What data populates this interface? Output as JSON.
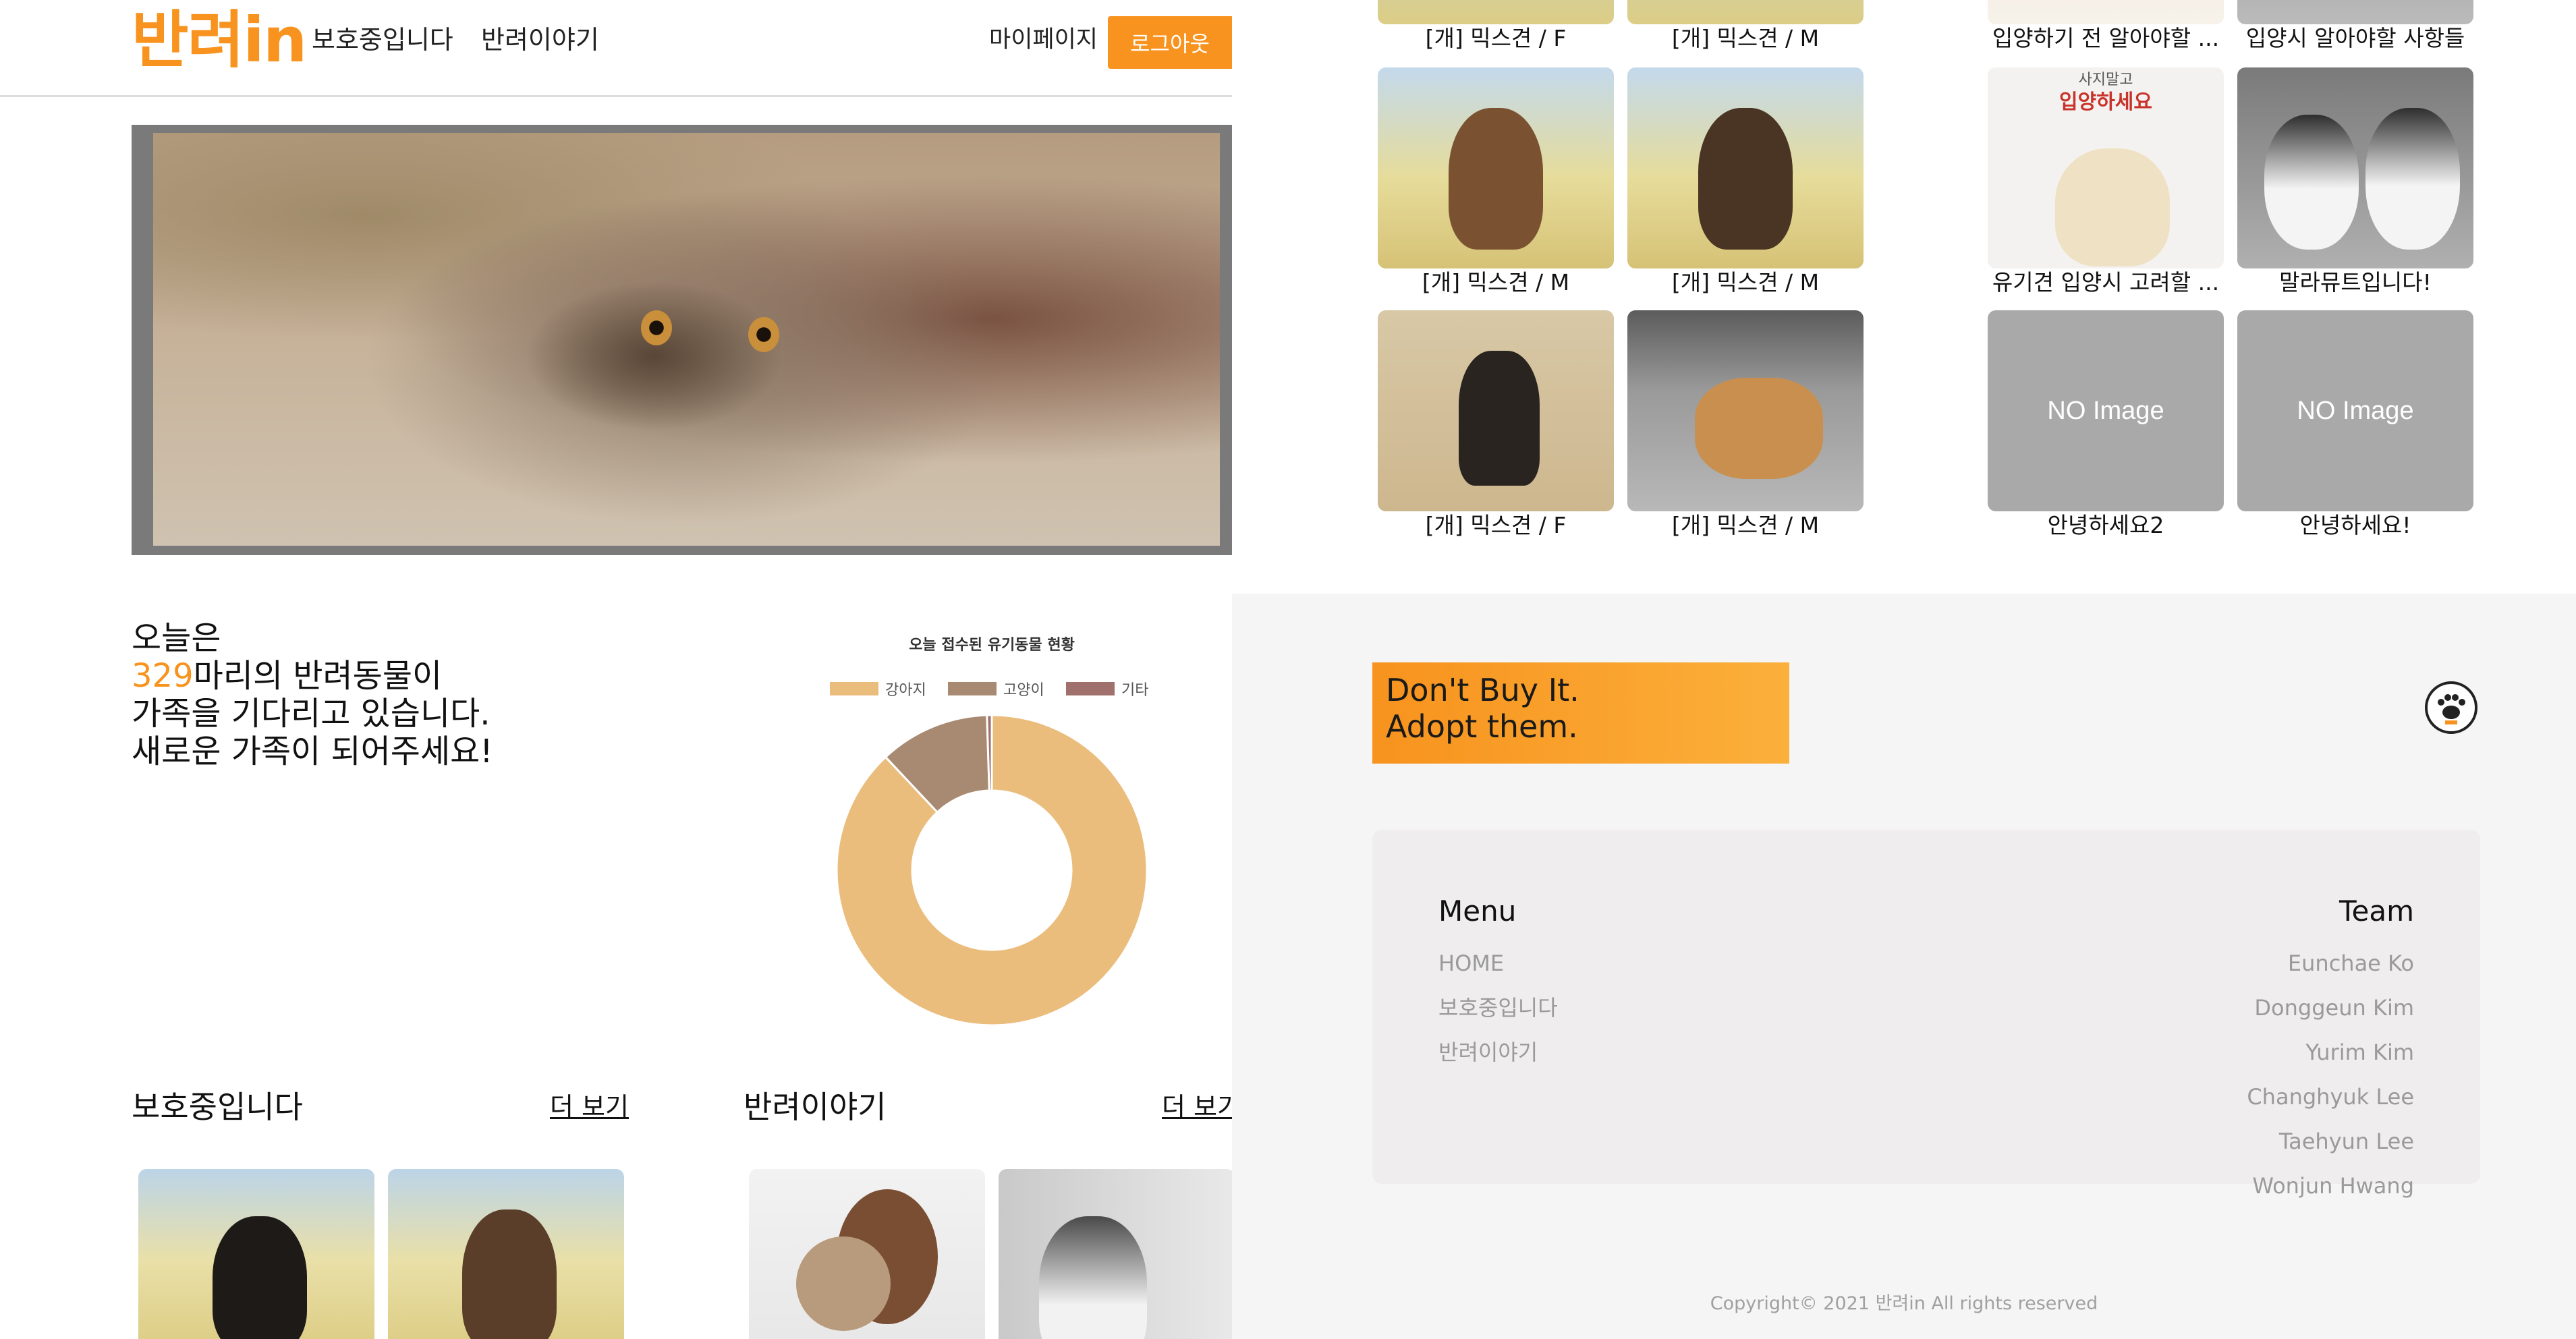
{
  "header": {
    "logo": "반려in",
    "nav": [
      "보호중입니다",
      "반려이야기"
    ],
    "mypage": "마이페이지",
    "logout": "로그아웃"
  },
  "intro": {
    "line1": "오늘은",
    "count": "329",
    "line2_suffix": "마리의 반려동물이",
    "line3": "가족을 기다리고 있습니다.",
    "line4": "새로운 가족이 되어주세요!"
  },
  "chart_data": {
    "type": "pie",
    "title": "오늘 접수된 유기동물 현황",
    "categories": [
      "강아지",
      "고양이",
      "기타"
    ],
    "values": [
      88,
      11.5,
      0.5
    ],
    "colors": [
      "#ebbd7d",
      "#a88a72",
      "#a0706c"
    ],
    "legend_position": "top"
  },
  "sections": {
    "protect": {
      "title": "보호중입니다",
      "more": "더 보기"
    },
    "story": {
      "title": "반려이야기",
      "more": "더 보기"
    }
  },
  "animals": [
    {
      "label": "[개] 믹스견 / F"
    },
    {
      "label": "[개] 믹스견 / M"
    },
    {
      "label": "[개] 믹스견 / M"
    },
    {
      "label": "[개] 믹스견 / M"
    },
    {
      "label": "[개] 믹스견 / F"
    },
    {
      "label": "[개] 믹스견 / M"
    }
  ],
  "stories": [
    {
      "label": "입양하기 전 알아야할 ..."
    },
    {
      "label": "입양시 알아야할 사항들"
    },
    {
      "label": "유기견 입양시 고려할 ...",
      "poster_small": "사지말고",
      "poster_big": "입양하세요"
    },
    {
      "label": "말라뮤트입니다!"
    },
    {
      "label": "안녕하세요2",
      "noimage": "NO Image"
    },
    {
      "label": "안녕하세요!",
      "noimage": "NO Image"
    }
  ],
  "footer": {
    "slogan_line1": "Don't Buy It.",
    "slogan_line2": "Adopt them.",
    "menu_title": "Menu",
    "menu": [
      "HOME",
      "보호중입니다",
      "반려이야기"
    ],
    "team_title": "Team",
    "team": [
      "Eunchae Ko",
      "Donggeun Kim",
      "Yurim Kim",
      "Changhyuk Lee",
      "Taehyun Lee",
      "Wonjun Hwang"
    ],
    "copyright": "Copyright© 2021 반려in All rights reserved"
  }
}
